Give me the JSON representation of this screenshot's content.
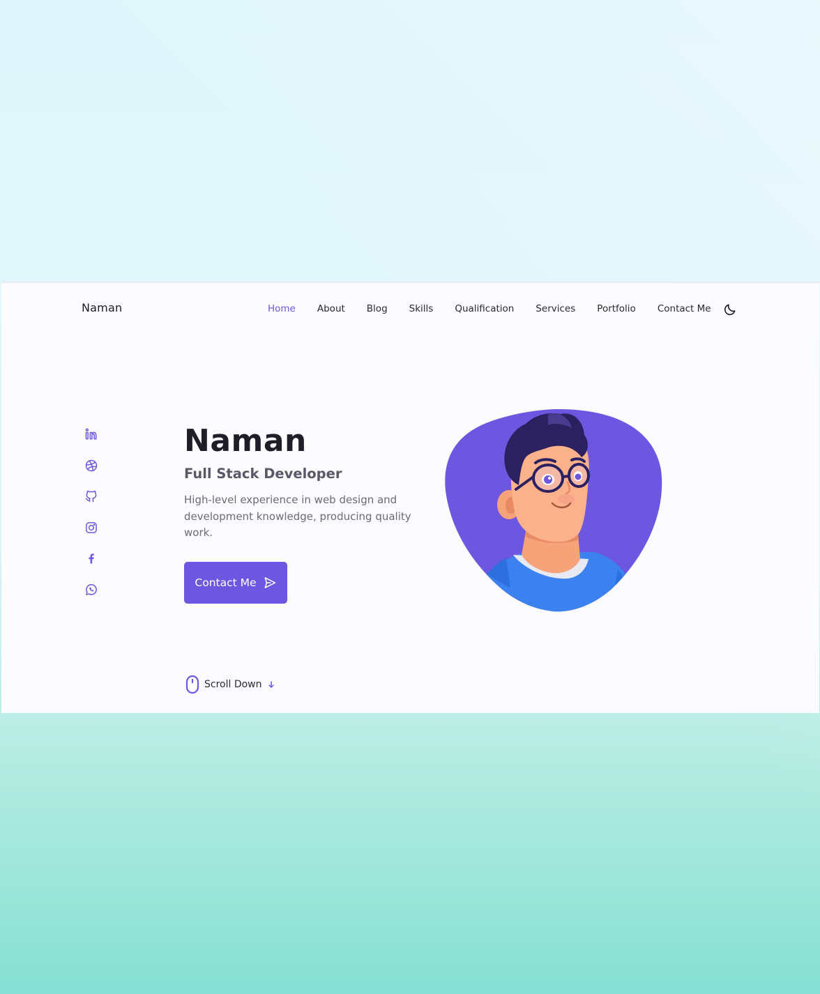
{
  "brand": "Naman",
  "nav": {
    "items": [
      {
        "label": "Home",
        "active": true
      },
      {
        "label": "About",
        "active": false
      },
      {
        "label": "Blog",
        "active": false
      },
      {
        "label": "Skills",
        "active": false
      },
      {
        "label": "Qualification",
        "active": false
      },
      {
        "label": "Services",
        "active": false
      },
      {
        "label": "Portfolio",
        "active": false
      },
      {
        "label": "Contact Me",
        "active": false
      }
    ],
    "theme_toggle_icon": "moon-icon"
  },
  "socials": [
    "linkedin-icon",
    "dribbble-icon",
    "github-icon",
    "instagram-icon",
    "facebook-icon",
    "whatsapp-icon"
  ],
  "hero": {
    "name": "Naman",
    "role": "Full Stack Developer",
    "description": "High-level experience in web design and development knowledge, producing quality work.",
    "button_label": "Contact Me",
    "button_icon": "send-icon"
  },
  "scroll": {
    "label": "Scroll Down",
    "icon": "mouse-icon",
    "arrow_icon": "arrow-down-icon"
  },
  "colors": {
    "accent": "#6e57e0",
    "text_dark": "#1f1d27",
    "text_muted": "#6b6a75",
    "page_bg": "#fcfbfe"
  }
}
